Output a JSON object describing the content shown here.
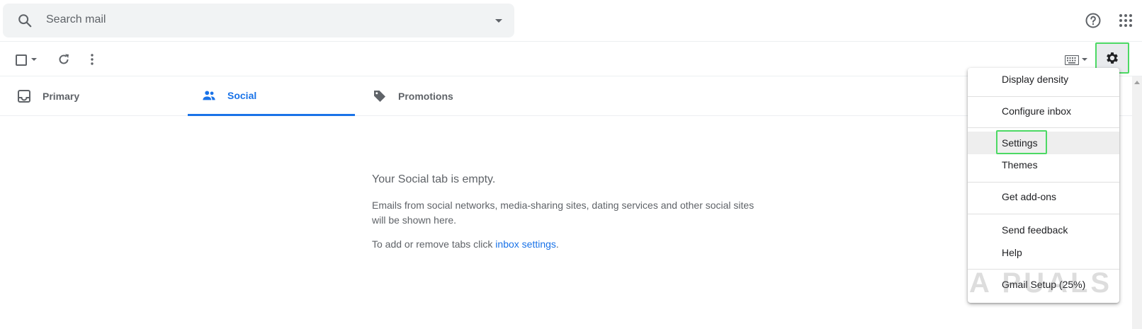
{
  "search": {
    "placeholder": "Search mail"
  },
  "header": {
    "help_icon": "help-circle-icon",
    "apps_icon": "apps-grid-icon"
  },
  "toolbar": {
    "select_icon": "checkbox-icon",
    "refresh_icon": "refresh-icon",
    "more_icon": "more-vertical-icon",
    "keyboard_icon": "keyboard-icon",
    "settings_icon": "gear-icon"
  },
  "tabs": [
    {
      "label": "Primary",
      "icon": "inbox-icon",
      "active": false
    },
    {
      "label": "Social",
      "icon": "people-icon",
      "active": true
    },
    {
      "label": "Promotions",
      "icon": "tag-icon",
      "active": false
    }
  ],
  "empty_state": {
    "title": "Your Social tab is empty.",
    "description": "Emails from social networks, media-sharing sites, dating services and other social sites will be shown here.",
    "hint_prefix": "To add or remove tabs click ",
    "hint_link": "inbox settings",
    "hint_suffix": "."
  },
  "settings_menu": {
    "items": [
      {
        "label": "Display density"
      },
      {
        "label": "Configure inbox"
      },
      {
        "label": "Settings"
      },
      {
        "label": "Themes"
      },
      {
        "label": "Get add-ons"
      },
      {
        "label": "Send feedback"
      },
      {
        "label": "Help"
      },
      {
        "label": "Gmail Setup (25%)"
      }
    ]
  },
  "watermark": "A PUALS",
  "colors": {
    "accent": "#1a73e8",
    "highlight": "#4cd964",
    "text_secondary": "#5f6368"
  }
}
